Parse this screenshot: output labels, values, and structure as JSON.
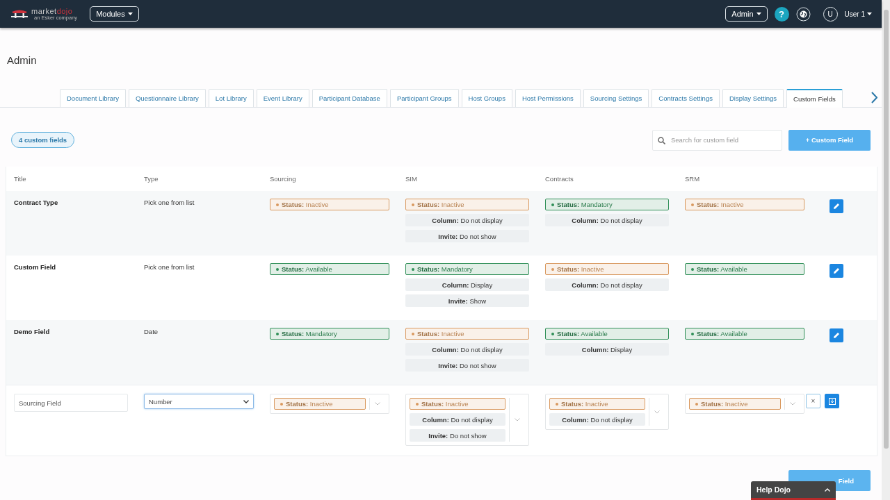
{
  "header": {
    "logo_words": [
      "market",
      "dojo"
    ],
    "logo_tagline": "an Esker company",
    "modules_button": "Modules",
    "admin_button": "Admin",
    "help_button": "?",
    "avatar": "U",
    "user_menu": "User 1"
  },
  "page_title": "Admin",
  "tabs": [
    {
      "label": "Document Library",
      "selected": false
    },
    {
      "label": "Questionnaire Library",
      "selected": false
    },
    {
      "label": "Lot Library",
      "selected": false
    },
    {
      "label": "Event Library",
      "selected": false
    },
    {
      "label": "Participant Database",
      "selected": false
    },
    {
      "label": "Participant Groups",
      "selected": false
    },
    {
      "label": "Host Groups",
      "selected": false
    },
    {
      "label": "Host Permissions",
      "selected": false
    },
    {
      "label": "Sourcing Settings",
      "selected": false
    },
    {
      "label": "Contracts Settings",
      "selected": false
    },
    {
      "label": "Display Settings",
      "selected": false
    },
    {
      "label": "Custom Fields",
      "selected": true
    }
  ],
  "toolbar": {
    "count_badge": "4 custom fields",
    "search": {
      "placeholder": "Search for custom field"
    },
    "add_button": "+ Custom Field"
  },
  "table": {
    "columns": [
      "Title",
      "Type",
      "Sourcing",
      "SIM",
      "Contracts",
      "SRM"
    ],
    "rows": [
      {
        "title": "Contract Type",
        "type": "Pick one from list",
        "cells": [
          [
            {
              "kind": "status",
              "label": "Status:",
              "value": "Inactive",
              "color": "#d9995f"
            }
          ],
          [
            {
              "kind": "status",
              "label": "Status:",
              "value": "Inactive",
              "color": "#d9995f"
            },
            {
              "kind": "setting",
              "label": "Column:",
              "value": "Do not display"
            },
            {
              "kind": "setting",
              "label": "Invite:",
              "value": "Do not show"
            }
          ],
          [
            {
              "kind": "status",
              "label": "Status:",
              "value": "Mandatory",
              "color": "#2f8f57"
            },
            {
              "kind": "setting",
              "label": "Column:",
              "value": "Do not display"
            }
          ],
          [
            {
              "kind": "status",
              "label": "Status:",
              "value": "Inactive",
              "color": "#d9995f"
            }
          ]
        ]
      },
      {
        "title": "Custom Field",
        "type": "Pick one from list",
        "cells": [
          [
            {
              "kind": "status",
              "label": "Status:",
              "value": "Available",
              "color": "#2f8f57"
            }
          ],
          [
            {
              "kind": "status",
              "label": "Status:",
              "value": "Mandatory",
              "color": "#2f8f57"
            },
            {
              "kind": "setting",
              "label": "Column:",
              "value": "Display"
            },
            {
              "kind": "setting",
              "label": "Invite:",
              "value": "Show"
            }
          ],
          [
            {
              "kind": "status",
              "label": "Status:",
              "value": "Inactive",
              "color": "#d9995f"
            },
            {
              "kind": "setting",
              "label": "Column:",
              "value": "Do not display"
            }
          ],
          [
            {
              "kind": "status",
              "label": "Status:",
              "value": "Available",
              "color": "#2f8f57"
            }
          ]
        ]
      },
      {
        "title": "Demo Field",
        "type": "Date",
        "cells": [
          [
            {
              "kind": "status",
              "label": "Status:",
              "value": "Mandatory",
              "color": "#2f8f57"
            }
          ],
          [
            {
              "kind": "status",
              "label": "Status:",
              "value": "Inactive",
              "color": "#d9995f"
            },
            {
              "kind": "setting",
              "label": "Column:",
              "value": "Do not display"
            },
            {
              "kind": "setting",
              "label": "Invite:",
              "value": "Do not show"
            }
          ],
          [
            {
              "kind": "status",
              "label": "Status:",
              "value": "Available",
              "color": "#2f8f57"
            },
            {
              "kind": "setting",
              "label": "Column:",
              "value": "Display"
            }
          ],
          [
            {
              "kind": "status",
              "label": "Status:",
              "value": "Available",
              "color": "#2f8f57"
            }
          ]
        ]
      }
    ],
    "edit_row": {
      "title_value": "Sourcing Field",
      "type_value": "Number",
      "cells": [
        [
          {
            "kind": "status",
            "label": "Status:",
            "value": "Inactive",
            "color": "#d9995f"
          }
        ],
        [
          {
            "kind": "status",
            "label": "Status:",
            "value": "Inactive",
            "color": "#d9995f"
          },
          {
            "kind": "setting",
            "label": "Column:",
            "value": "Do not display"
          },
          {
            "kind": "setting",
            "label": "Invite:",
            "value": "Do not show"
          }
        ],
        [
          {
            "kind": "status",
            "label": "Status:",
            "value": "Inactive",
            "color": "#d9995f"
          },
          {
            "kind": "setting",
            "label": "Column:",
            "value": "Do not display"
          }
        ],
        [
          {
            "kind": "status",
            "label": "Status:",
            "value": "Inactive",
            "color": "#d9995f"
          }
        ]
      ],
      "cancel_button": "×"
    }
  },
  "footer_button": "Field",
  "help_widget": {
    "label": "Help Dojo"
  }
}
